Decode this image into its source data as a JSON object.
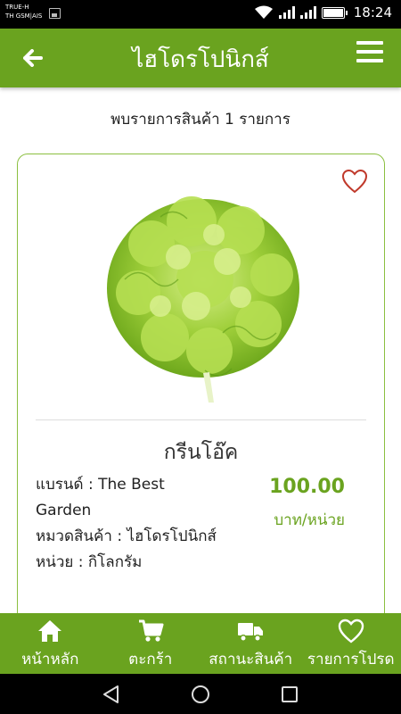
{
  "status_bar": {
    "carrier_line1": "TRUE-H",
    "carrier_line2": "TH GSM|AIS",
    "time": "18:24"
  },
  "app_bar": {
    "title": "ไฮโดรโปนิกส์",
    "back_icon": "arrow-left-icon",
    "menu_icon": "hamburger-menu-icon"
  },
  "results": {
    "count_text": "พบรายการสินค้า 1 รายการ"
  },
  "product": {
    "name": "กรีนโอ๊ค",
    "brand": "แบรนด์ : The Best Garden",
    "category": "หมวดสินค้า : ไฮโดรโปนิกส์",
    "unit": "หน่วย : กิโลกรัม",
    "price": "100.00",
    "price_unit": "บาท/หน่วย",
    "favorite_icon": "heart-outline-icon",
    "image": "lettuce-photo"
  },
  "bottom_nav": [
    {
      "label": "หน้าหลัก",
      "icon": "home-icon"
    },
    {
      "label": "ตะกร้า",
      "icon": "cart-icon"
    },
    {
      "label": "สถานะสินค้า",
      "icon": "truck-icon"
    },
    {
      "label": "รายการโปรด",
      "icon": "heart-icon"
    }
  ],
  "colors": {
    "primary": "#6aa31f",
    "card_border": "#8bbf3f",
    "favorite": "#c0392b"
  }
}
